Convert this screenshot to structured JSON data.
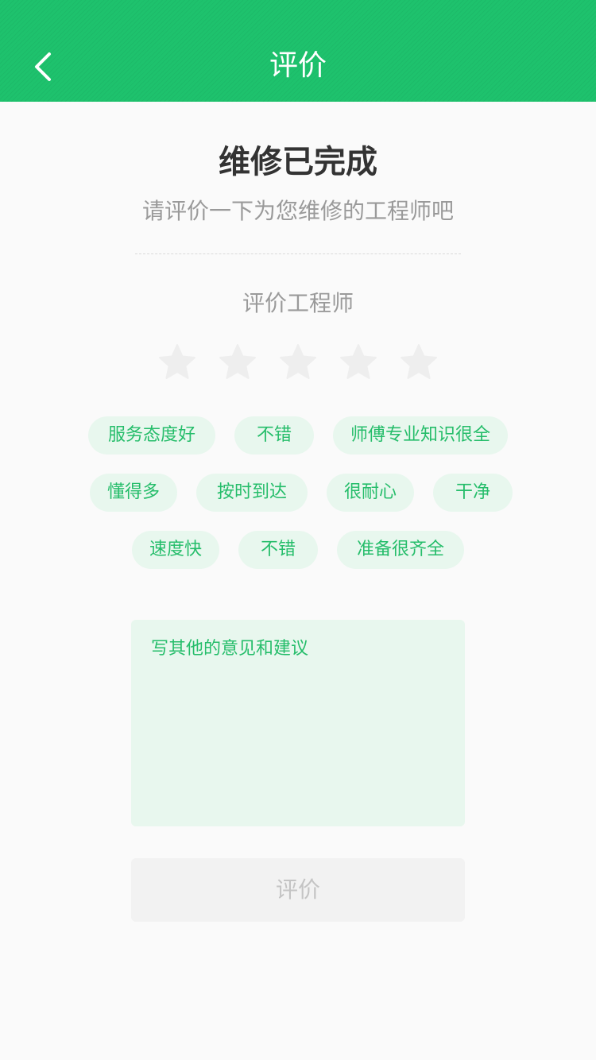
{
  "header": {
    "title": "评价",
    "back_icon": "chevron-left-icon"
  },
  "completion": {
    "title": "维修已完成",
    "subtitle": "请评价一下为您维修的工程师吧"
  },
  "rating": {
    "label": "评价工程师",
    "star_icon": "star-icon",
    "value": 0,
    "max": 5
  },
  "tags": [
    "服务态度好",
    "不错",
    "师傅专业知识很全",
    "懂得多",
    "按时到达",
    "很耐心",
    "干净",
    "速度快",
    "不错",
    "准备很齐全"
  ],
  "comment": {
    "placeholder": "写其他的意见和建议",
    "value": ""
  },
  "submit": {
    "label": "评价"
  },
  "colors": {
    "brand": "#1ec26d",
    "tag_background": "#e8f7ee",
    "tag_text": "#25bd6a",
    "star_inactive": "#eeeeee",
    "disabled_text": "#c4c4c4"
  }
}
